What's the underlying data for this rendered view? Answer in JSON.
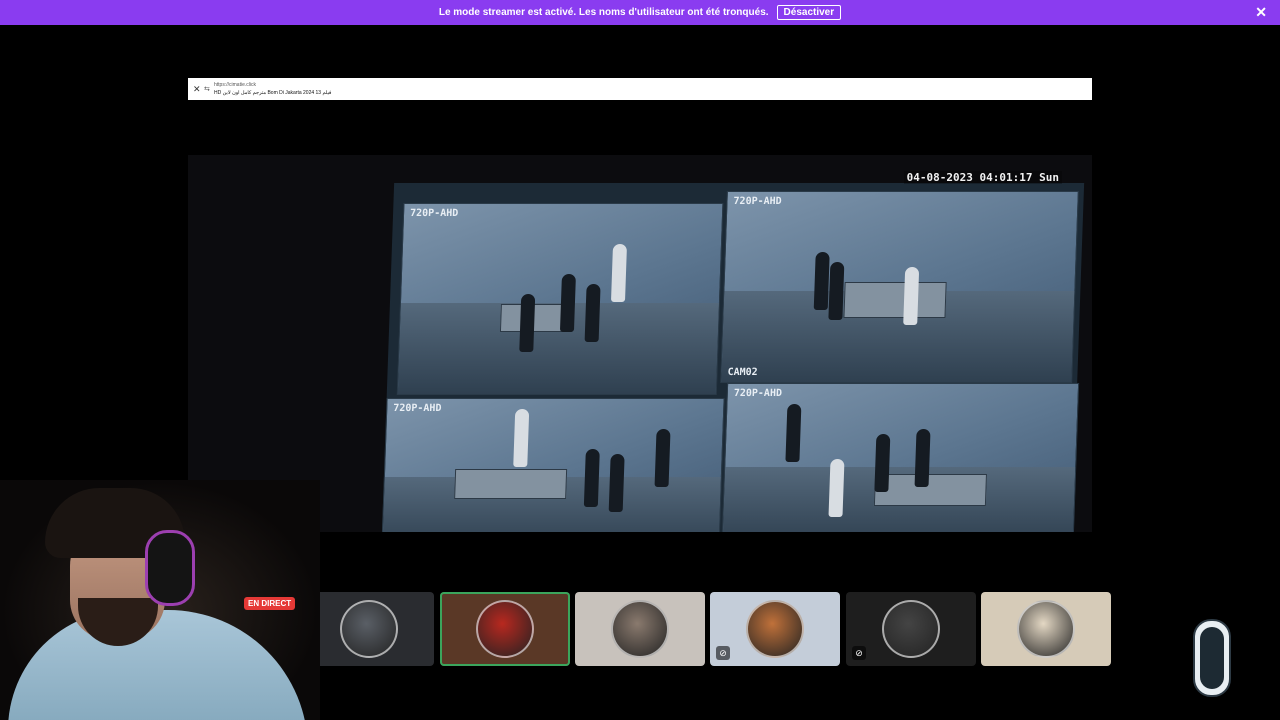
{
  "banner": {
    "message": "Le mode streamer est activé. Les noms d'utilisateur ont été tronqués.",
    "disable_label": "Désactiver",
    "close_glyph": "✕",
    "color": "#8a3cf0"
  },
  "browser": {
    "close_glyph": "✕",
    "url": "https://cimatie.click",
    "title": "HD مترجم كامل اون لاين Bom Di Jakarta 2024 13 فيلم"
  },
  "video": {
    "cam_labels": [
      "720P-AHD",
      "720P-AHD",
      "720P-AHD",
      "720P-AHD"
    ],
    "cam02_label": "CAM02",
    "timestamp": "04-08-2023 04:01:17 Sun"
  },
  "stream": {
    "live_label": "EN DIRECT",
    "live_color": "#e53936"
  },
  "participants": [
    {
      "avatar": "globe-avatar",
      "bg": "#2a2c30",
      "muted": false,
      "speaking": false
    },
    {
      "avatar": "red-hood-avatar",
      "bg": "#5a3826",
      "muted": false,
      "speaking": true
    },
    {
      "avatar": "driver-avatar",
      "bg": "#c8c2bc",
      "muted": false,
      "speaking": false
    },
    {
      "avatar": "fox-mask-avatar",
      "bg": "#c4cdd9",
      "muted": true,
      "speaking": false
    },
    {
      "avatar": "car-avatar",
      "bg": "#1e1e1e",
      "muted": true,
      "speaking": false
    },
    {
      "avatar": "woman-avatar",
      "bg": "#d6cbb8",
      "muted": false,
      "speaking": false
    }
  ],
  "icons": {
    "mute": "mic-off-icon",
    "badge": "team-logo-icon"
  }
}
